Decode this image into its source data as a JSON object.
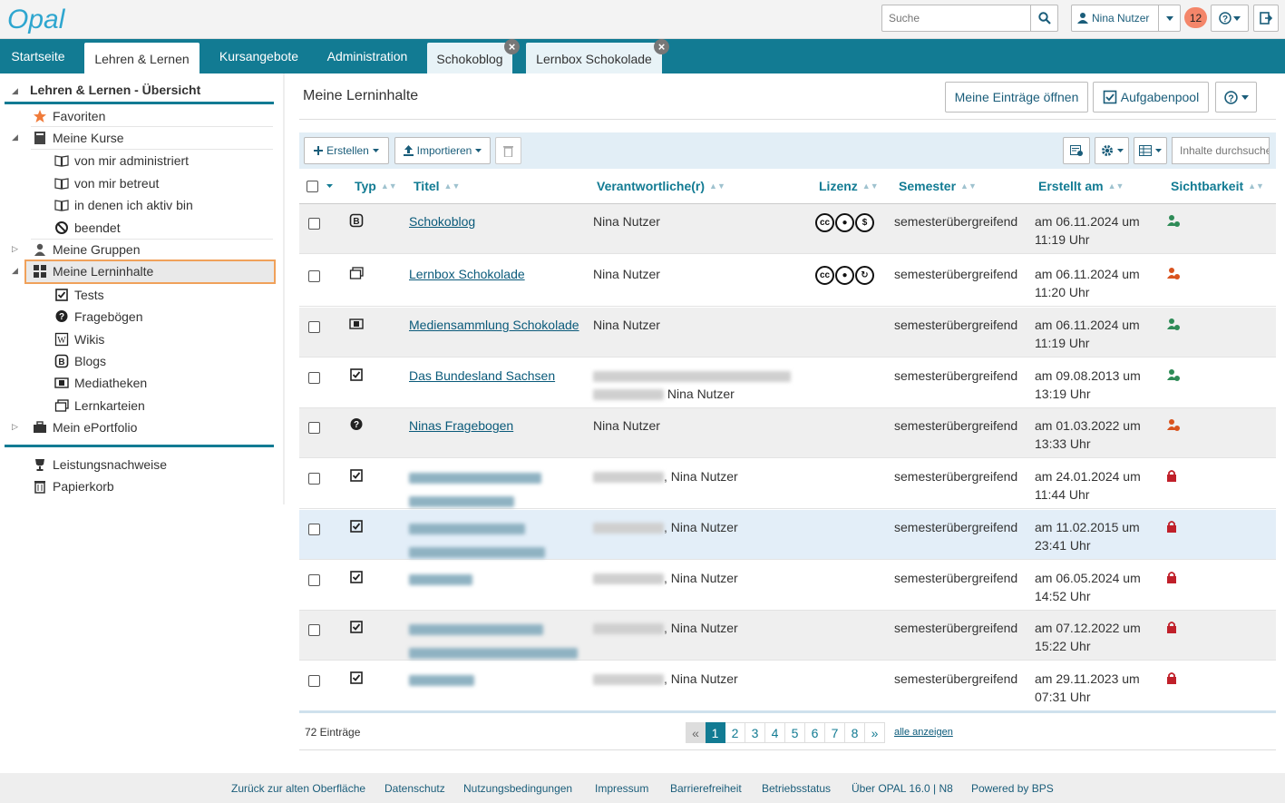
{
  "header": {
    "logo_text": "Opal",
    "search_placeholder": "Suche",
    "user_name": "Nina Nutzer",
    "notifications": "12"
  },
  "nav": {
    "tabs": [
      "Startseite",
      "Lehren & Lernen",
      "Kursangebote",
      "Administration",
      "Schokoblog",
      "Lernbox Schokolade"
    ]
  },
  "sidebar": {
    "title": "Lehren & Lernen - Übersicht",
    "favoriten": "Favoriten",
    "meine_kurse": "Meine Kurse",
    "kurse_sub": [
      "von mir administriert",
      "von mir betreut",
      "in denen ich aktiv bin",
      "beendet"
    ],
    "meine_gruppen": "Meine Gruppen",
    "meine_lerninhalte": "Meine Lerninhalte",
    "lerninhalte_sub": [
      "Tests",
      "Fragebögen",
      "Wikis",
      "Blogs",
      "Mediatheken",
      "Lernkarteien"
    ],
    "mein_eportfolio": "Mein ePortfolio",
    "leistungsnachweise": "Leistungsnachweise",
    "papierkorb": "Papierkorb"
  },
  "main": {
    "title": "Meine Lerninhalte",
    "btn_eintraege": "Meine Einträge öffnen",
    "btn_aufgabenpool": "Aufgabenpool",
    "btn_erstellen": "Erstellen",
    "btn_importieren": "Importieren",
    "search_placeholder": "Inhalte durchsuchen",
    "columns": [
      "Typ",
      "Titel",
      "Verantwortliche(r)",
      "Lizenz",
      "Semester",
      "Erstellt am",
      "Sichtbarkeit"
    ]
  },
  "rows": [
    {
      "type": "blog",
      "title": "Schokoblog",
      "owner": "Nina Nutzer",
      "license": [
        "cc",
        "by",
        "nc"
      ],
      "semester": "semesterübergreifend",
      "created": "am 06.11.2024 um",
      "time": "11:19 Uhr",
      "visibility": "public"
    },
    {
      "type": "cards",
      "title": "Lernbox Schokolade",
      "owner": "Nina Nutzer",
      "license": [
        "cc",
        "by",
        "sa"
      ],
      "semester": "semesterübergreifend",
      "created": "am 06.11.2024 um",
      "time": "11:20 Uhr",
      "visibility": "restricted"
    },
    {
      "type": "media",
      "title": "Mediensammlung Schokolade",
      "owner": "Nina Nutzer",
      "license": [],
      "semester": "semesterübergreifend",
      "created": "am 06.11.2024 um",
      "time": "11:19 Uhr",
      "visibility": "public"
    },
    {
      "type": "test",
      "title": "Das Bundesland Sachsen",
      "owner": "Nina Nutzer",
      "license": [],
      "semester": "semesterübergreifend",
      "created": "am 09.08.2013 um",
      "time": "13:19 Uhr",
      "visibility": "public"
    },
    {
      "type": "survey",
      "title": "Ninas Fragebogen",
      "owner": "Nina Nutzer",
      "license": [],
      "semester": "semesterübergreifend",
      "created": "am 01.03.2022 um",
      "time": "13:33 Uhr",
      "visibility": "restricted"
    },
    {
      "type": "test",
      "title": "",
      "owner": "Nina Nutzer",
      "license": [],
      "semester": "semesterübergreifend",
      "created": "am 24.01.2024 um",
      "time": "11:44 Uhr",
      "visibility": "locked"
    },
    {
      "type": "test",
      "title": "",
      "owner": "Nina Nutzer",
      "license": [],
      "semester": "semesterübergreifend",
      "created": "am 11.02.2015 um",
      "time": "23:41 Uhr",
      "visibility": "locked"
    },
    {
      "type": "test",
      "title": "",
      "owner": "Nina Nutzer",
      "license": [],
      "semester": "semesterübergreifend",
      "created": "am 06.05.2024 um",
      "time": "14:52 Uhr",
      "visibility": "locked"
    },
    {
      "type": "test",
      "title": "",
      "owner": "Nina Nutzer",
      "license": [],
      "semester": "semesterübergreifend",
      "created": "am 07.12.2022 um",
      "time": "15:22 Uhr",
      "visibility": "locked"
    },
    {
      "type": "test",
      "title": "",
      "owner": "Nina Nutzer",
      "license": [],
      "semester": "semesterübergreifend",
      "created": "am 29.11.2023 um",
      "time": "07:31 Uhr",
      "visibility": "locked"
    }
  ],
  "pagination": {
    "count": "72 Einträge",
    "prev": "«",
    "pages": [
      "1",
      "2",
      "3",
      "4",
      "5",
      "6",
      "7",
      "8"
    ],
    "next": "»",
    "show_all": "alle anzeigen"
  },
  "footer": {
    "links": [
      "Zurück zur alten Oberfläche",
      "Datenschutz",
      "Nutzungsbedingungen",
      "Impressum",
      "Barrierefreiheit",
      "Betriebsstatus",
      "Über OPAL 16.0 | N8",
      "Powered by BPS"
    ]
  },
  "colors": {
    "brand": "#127b93",
    "public": "#2e8b57",
    "restricted": "#d9531e",
    "locked": "#c0202a"
  }
}
